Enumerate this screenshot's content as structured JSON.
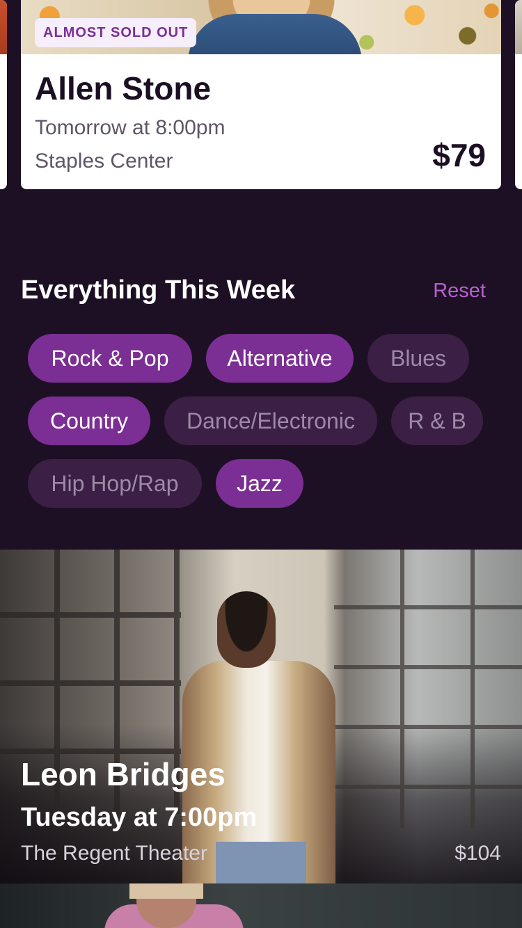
{
  "top_card": {
    "badge": "ALMOST SOLD OUT",
    "title": "Allen Stone",
    "time": "Tomorrow at 8:00pm",
    "venue": "Staples Center",
    "price": "$79"
  },
  "filters": {
    "title": "Everything This Week",
    "reset_label": "Reset",
    "chips": [
      {
        "label": "Rock & Pop",
        "selected": true
      },
      {
        "label": "Alternative",
        "selected": true
      },
      {
        "label": "Blues",
        "selected": false
      },
      {
        "label": "Country",
        "selected": true
      },
      {
        "label": "Dance/Electronic",
        "selected": false
      },
      {
        "label": "R & B",
        "selected": false
      },
      {
        "label": "Hip Hop/Rap",
        "selected": false
      },
      {
        "label": "Jazz",
        "selected": true
      }
    ]
  },
  "featured": {
    "title": "Leon Bridges",
    "time": "Tuesday at 7:00pm",
    "venue": "The Regent Theater",
    "price": "$104"
  },
  "colors": {
    "background": "#1e1024",
    "accent": "#7b2e93",
    "chip_unselected": "#3b1f45",
    "reset_link": "#b661d1"
  }
}
